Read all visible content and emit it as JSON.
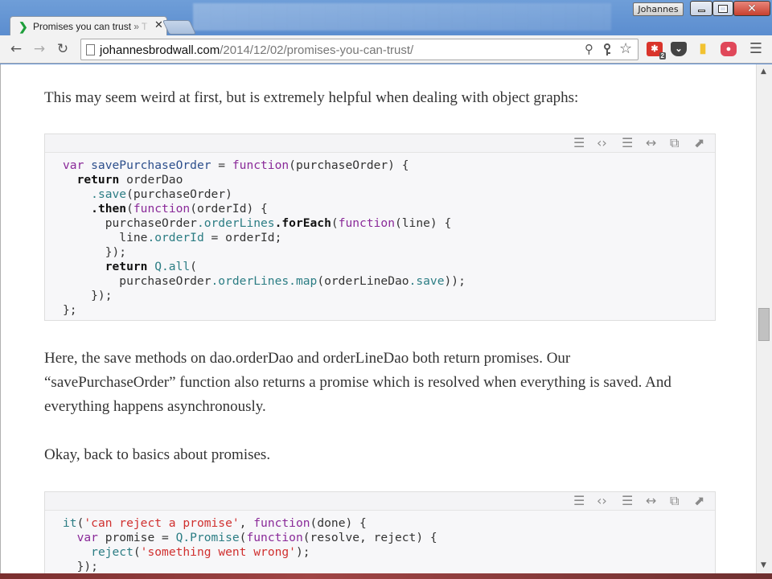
{
  "window": {
    "user_name": "Johannes",
    "close_glyph": "✕"
  },
  "tab": {
    "title": "Promises you can trust » T",
    "close_glyph": "✕"
  },
  "toolbar": {
    "back_glyph": "←",
    "forward_glyph": "→",
    "reload_glyph": "↻",
    "url_host": "johannesbrodwall.com",
    "url_path": "/2014/12/02/promises-you-can-trust/",
    "zoom_glyph": "⚲",
    "star_glyph": "☆",
    "menu_glyph": "☰",
    "extension_badge": "2",
    "colors": {
      "ext_red": "#d9342b",
      "ext_dark": "#444444",
      "ext_yellow": "#f2c230",
      "ext_pink": "#e0485a"
    }
  },
  "article": {
    "para1": "This may seem weird at first, but is extremely helpful when dealing with object graphs:",
    "para2": "Here, the save methods on dao.orderDao and orderLineDao both return promises. Our “savePurchaseOrder” function also returns a promise which is resolved when everything is saved. And everything happens asynchronously.",
    "para3": "Okay, back to basics about promises."
  },
  "code_toolbar_icons": [
    "view-source-icon",
    "code-icon",
    "wrap-icon",
    "expand-icon",
    "copy-icon",
    "popup-icon"
  ],
  "code_toolbar_glyphs": [
    "☰",
    "‹›",
    "☰",
    "↔",
    "⧉",
    "⬈"
  ],
  "code1": [
    [
      [
        "kw",
        "var"
      ],
      [
        "var",
        " savePurchaseOrder"
      ],
      [
        "p",
        " = "
      ],
      [
        "kw",
        "function"
      ],
      [
        "p",
        "(purchaseOrder) {"
      ]
    ],
    [
      [
        "p",
        "  "
      ],
      [
        "kwb",
        "return"
      ],
      [
        "p",
        " orderDao"
      ]
    ],
    [
      [
        "p",
        "    "
      ],
      [
        "prop",
        ".save"
      ],
      [
        "p",
        "(purchaseOrder)"
      ]
    ],
    [
      [
        "p",
        "    "
      ],
      [
        "kwb",
        ".then"
      ],
      [
        "p",
        "("
      ],
      [
        "kw",
        "function"
      ],
      [
        "p",
        "(orderId) {"
      ]
    ],
    [
      [
        "p",
        "      purchaseOrder"
      ],
      [
        "prop",
        ".orderLines"
      ],
      [
        "kwb",
        ".forEach"
      ],
      [
        "p",
        "("
      ],
      [
        "kw",
        "function"
      ],
      [
        "p",
        "(line) {"
      ]
    ],
    [
      [
        "p",
        "        line"
      ],
      [
        "prop",
        ".orderId"
      ],
      [
        "p",
        " = orderId;"
      ]
    ],
    [
      [
        "p",
        "      });"
      ]
    ],
    [
      [
        "p",
        "      "
      ],
      [
        "kwb",
        "return"
      ],
      [
        "p",
        " "
      ],
      [
        "prop",
        "Q.all"
      ],
      [
        "p",
        "("
      ]
    ],
    [
      [
        "p",
        "        purchaseOrder"
      ],
      [
        "prop",
        ".orderLines"
      ],
      [
        "prop",
        ".map"
      ],
      [
        "p",
        "(orderLineDao"
      ],
      [
        "prop",
        ".save"
      ],
      [
        "p",
        "));"
      ]
    ],
    [
      [
        "p",
        "    });"
      ]
    ],
    [
      [
        "p",
        "};"
      ]
    ]
  ],
  "code2": [
    [
      [
        "prop",
        "it"
      ],
      [
        "p",
        "("
      ],
      [
        "str",
        "'can reject a promise'"
      ],
      [
        "p",
        ", "
      ],
      [
        "kw",
        "function"
      ],
      [
        "p",
        "(done) {"
      ]
    ],
    [
      [
        "p",
        "  "
      ],
      [
        "kw",
        "var"
      ],
      [
        "p",
        " promise = "
      ],
      [
        "prop",
        "Q.Promise"
      ],
      [
        "p",
        "("
      ],
      [
        "kw",
        "function"
      ],
      [
        "p",
        "(resolve, reject) {"
      ]
    ],
    [
      [
        "p",
        "    "
      ],
      [
        "prop",
        "reject"
      ],
      [
        "p",
        "("
      ],
      [
        "str",
        "'something went wrong'"
      ],
      [
        "p",
        ");"
      ]
    ],
    [
      [
        "p",
        "  });"
      ]
    ]
  ]
}
